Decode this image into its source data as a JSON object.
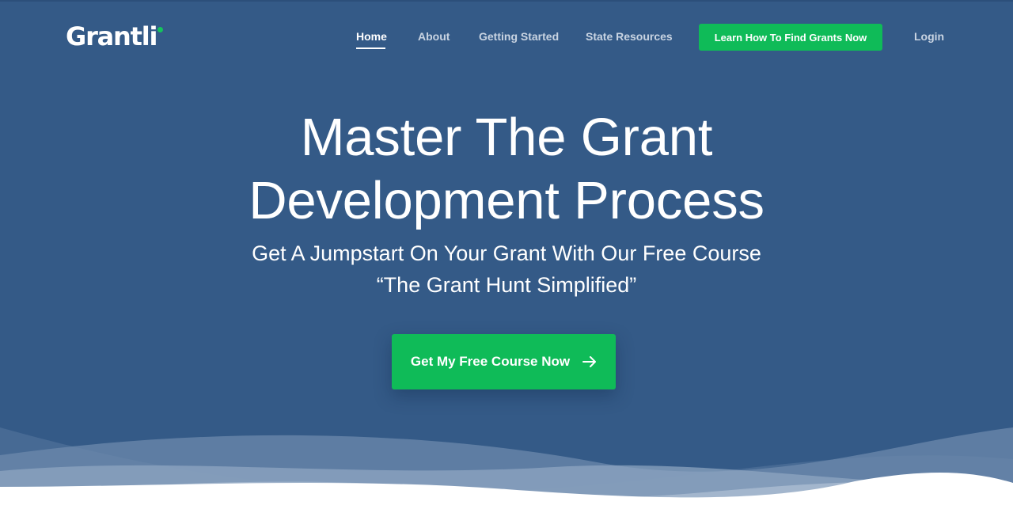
{
  "brand": {
    "logo_text": "Grantli",
    "accent_color": "#0fbb58",
    "background_color": "#345a87"
  },
  "nav": {
    "items": [
      {
        "label": "Home",
        "active": true
      },
      {
        "label": "About",
        "active": false
      },
      {
        "label": "Getting Started",
        "active": false
      },
      {
        "label": "State Resources",
        "active": false
      }
    ],
    "cta_label": "Learn How To Find Grants Now",
    "login_label": "Login"
  },
  "hero": {
    "headline_line1": "Master The Grant",
    "headline_line2": "Development Process",
    "subhead_line1": "Get A Jumpstart On Your Grant With Our Free Course",
    "subhead_line2": "“The Grant Hunt Simplified”",
    "button_label": "Get My Free Course Now",
    "button_icon": "arrow-right-icon"
  }
}
